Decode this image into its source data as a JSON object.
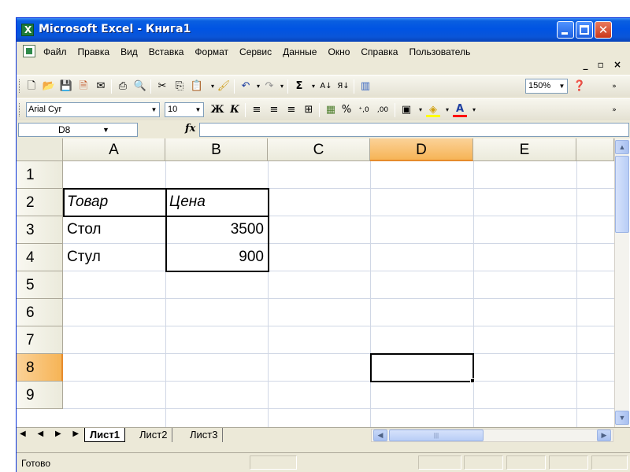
{
  "window": {
    "title": "Microsoft Excel - Книга1",
    "min_glyph": "",
    "close_glyph": "✕"
  },
  "menu": {
    "items": [
      "Файл",
      "Правка",
      "Вид",
      "Вставка",
      "Формат",
      "Сервис",
      "Данные",
      "Окно",
      "Справка",
      "Пользователь"
    ],
    "doc_controls": "_ ▫ ×"
  },
  "toolbar_standard": {
    "icons": [
      "new-icon",
      "open-icon",
      "save-icon",
      "permission-icon",
      "print-icon",
      "print-preview-icon",
      "spelling-icon",
      "cut-icon",
      "copy-icon",
      "paste-icon",
      "format-painter-icon",
      "undo-icon",
      "redo-icon",
      "autosum-icon",
      "sort-ascending-icon",
      "sort-descending-icon",
      "chart-wizard-icon",
      "help-icon"
    ],
    "zoom": "150%"
  },
  "toolbar_format": {
    "font": "Arial Cyr",
    "size": "10",
    "bold": "Ж",
    "italic": "К",
    "font_color_letter": "A",
    "percent": "%",
    "inc_decimal": "⁺,0",
    "dec_decimal": ",00"
  },
  "formula_bar": {
    "name_box": "D8",
    "fx": "fx",
    "value": ""
  },
  "grid": {
    "columns": [
      "A",
      "B",
      "C",
      "D",
      "E"
    ],
    "rows": [
      "1",
      "2",
      "3",
      "4",
      "5",
      "6",
      "7",
      "8",
      "9"
    ],
    "active_cell": "D8",
    "cells": {
      "A2": "Товар",
      "B2": "Цена",
      "A3": "Стол",
      "B3": "3500",
      "A4": "Стул",
      "B4": "900"
    }
  },
  "sheets": {
    "tabs": [
      "Лист1",
      "Лист2",
      "Лист3"
    ],
    "active": "Лист1",
    "nav": "◀ ◀ ▶ ▶"
  },
  "status": {
    "text": "Готово"
  },
  "colors": {
    "title_bar": "#0054e3",
    "active_header": "#f6b456",
    "close_button": "#c9381c"
  }
}
